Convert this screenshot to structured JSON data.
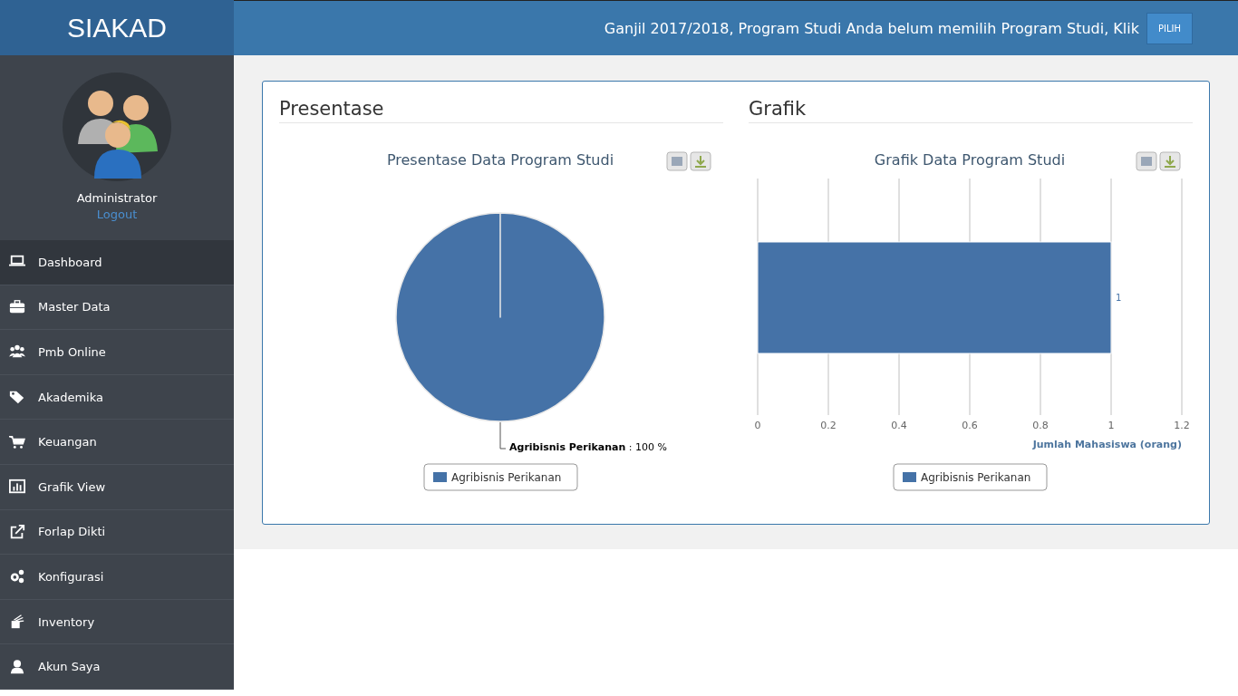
{
  "brand": "SIAKAD",
  "header": {
    "notice": "Ganjil 2017/2018, Program Studi Anda belum memilih Program Studi, Klik",
    "button": "PILIH"
  },
  "user": {
    "name": "Administrator",
    "logout": "Logout"
  },
  "sidebar": {
    "items": [
      {
        "label": "Dashboard",
        "selected": true
      },
      {
        "label": "Master Data",
        "selected": false
      },
      {
        "label": "Pmb Online",
        "selected": false
      },
      {
        "label": "Akademika",
        "selected": false
      },
      {
        "label": "Keuangan",
        "selected": false
      },
      {
        "label": "Grafik View",
        "selected": false
      },
      {
        "label": "Forlap Dikti",
        "selected": false
      },
      {
        "label": "Konfigurasi",
        "selected": false
      },
      {
        "label": "Inventory",
        "selected": false
      },
      {
        "label": "Akun Saya",
        "selected": false
      }
    ]
  },
  "panels": [
    {
      "heading": "Presentase",
      "chart_data": {
        "type": "pie",
        "title": "Presentase Data Program Studi",
        "categories": [
          "Agribisnis Perikanan"
        ],
        "values": [
          100
        ],
        "colors": [
          "#4572a7"
        ],
        "value_labels": [
          "**Agribisnis Perikanan** : 100 %"
        ]
      }
    },
    {
      "heading": "Grafik",
      "chart_data": {
        "type": "bar",
        "orientation": "horizontal",
        "grid": true,
        "title": "Grafik Data Program Studi",
        "xlabel": "Jumlah Mahasiswa (orang)",
        "xlim": [
          0,
          1.2
        ],
        "xticks": [
          0,
          0.2,
          0.4,
          0.6,
          0.8,
          1,
          1.2
        ],
        "series": [
          {
            "name": "Agribisnis Perikanan",
            "color": "#4572a7",
            "values": [
              1
            ]
          }
        ],
        "value_labels": [
          "1"
        ]
      }
    }
  ]
}
